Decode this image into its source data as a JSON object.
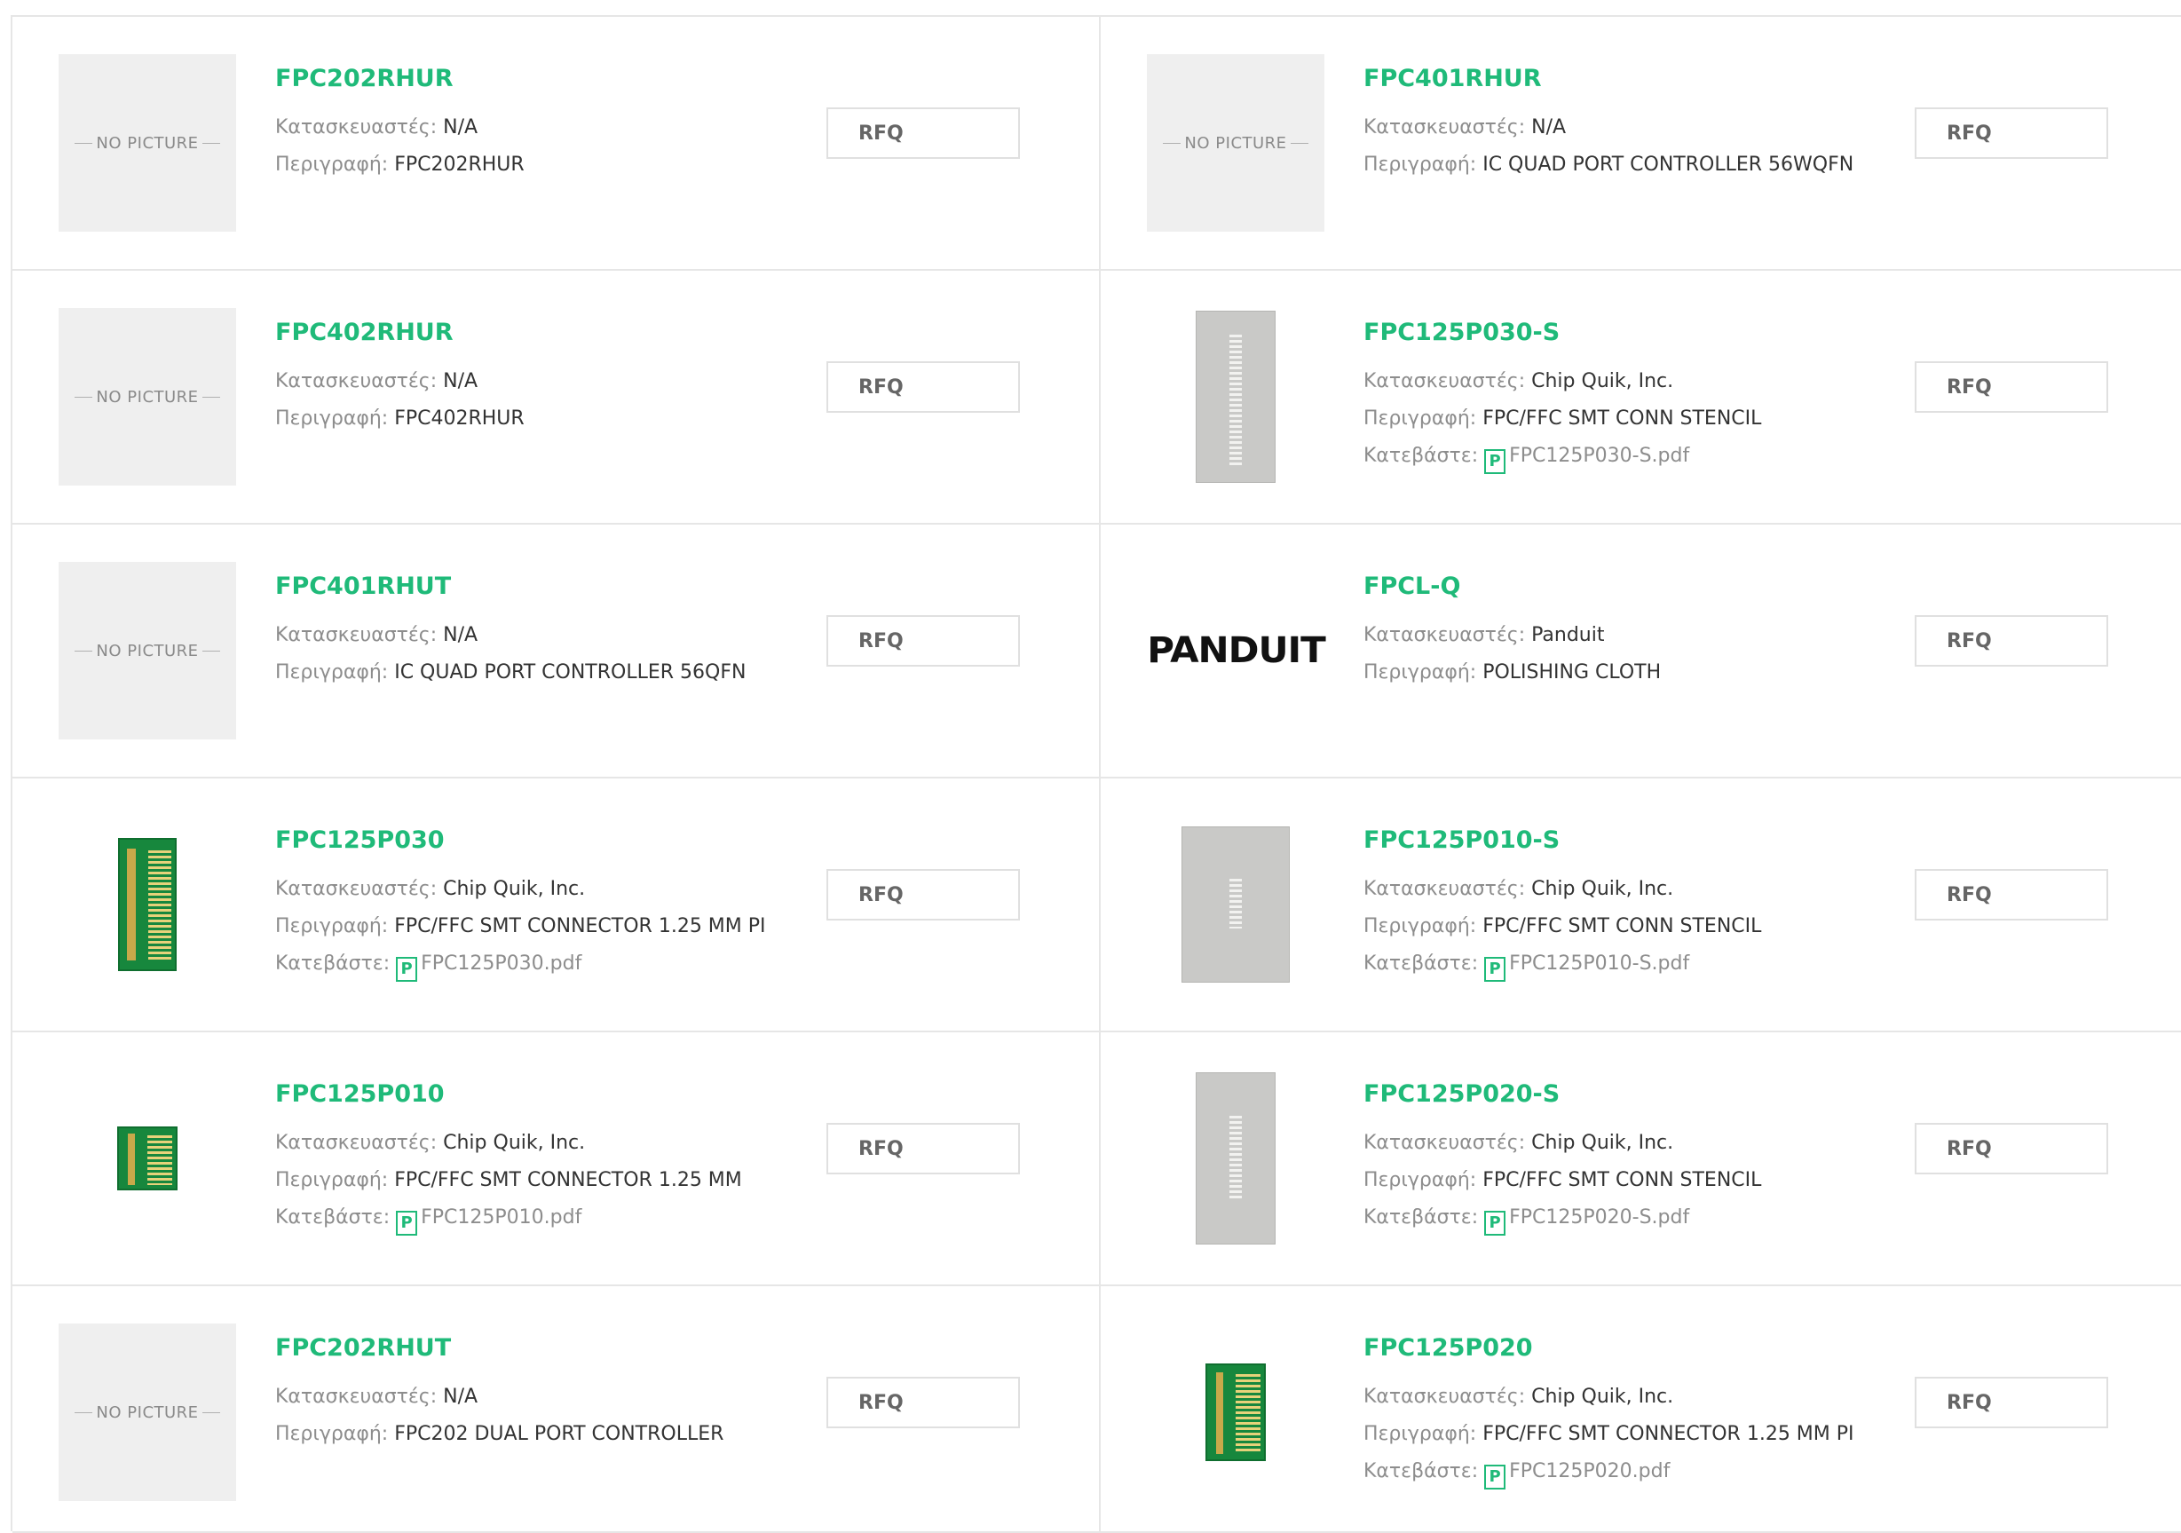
{
  "labels": {
    "manufacturer": "Κατασκευαστές:",
    "description": "Περιγραφή:",
    "download": "Κατεβάστε:",
    "no_picture": "NO PICTURE",
    "rfq": "RFQ",
    "pdf_icon_glyph": "P"
  },
  "colors": {
    "accent": "#1fba79",
    "label": "#8d8d8d",
    "value": "#333333"
  },
  "products": [
    {
      "part": "FPC202RHUR",
      "manufacturer": "N/A",
      "description": "FPC202RHUR",
      "image": "no-picture"
    },
    {
      "part": "FPC401RHUR",
      "manufacturer": "N/A",
      "description": "IC QUAD PORT CONTROLLER 56WQFN",
      "image": "no-picture"
    },
    {
      "part": "FPC402RHUR",
      "manufacturer": "N/A",
      "description": "FPC402RHUR",
      "image": "no-picture"
    },
    {
      "part": "FPC125P030-S",
      "manufacturer": "Chip Quik, Inc.",
      "description": "FPC/FFC SMT CONN STENCIL",
      "datasheet": "FPC125P030-S.pdf",
      "image": "stencil"
    },
    {
      "part": "FPC401RHUT",
      "manufacturer": "N/A",
      "description": "IC QUAD PORT CONTROLLER 56QFN",
      "image": "no-picture"
    },
    {
      "part": "FPCL-Q",
      "manufacturer": "Panduit",
      "description": "POLISHING CLOTH",
      "image": "panduit-logo",
      "logo_text": "PANDUIT"
    },
    {
      "part": "FPC125P030",
      "manufacturer": "Chip Quik, Inc.",
      "description": "FPC/FFC SMT CONNECTOR 1.25 MM PI",
      "datasheet": "FPC125P030.pdf",
      "image": "pcb"
    },
    {
      "part": "FPC125P010-S",
      "manufacturer": "Chip Quik, Inc.",
      "description": "FPC/FFC SMT CONN STENCIL",
      "datasheet": "FPC125P010-S.pdf",
      "image": "stencil"
    },
    {
      "part": "FPC125P010",
      "manufacturer": "Chip Quik, Inc.",
      "description": "FPC/FFC SMT CONNECTOR 1.25 MM",
      "datasheet": "FPC125P010.pdf",
      "image": "pcb"
    },
    {
      "part": "FPC125P020-S",
      "manufacturer": "Chip Quik, Inc.",
      "description": "FPC/FFC SMT CONN STENCIL",
      "datasheet": "FPC125P020-S.pdf",
      "image": "stencil"
    },
    {
      "part": "FPC202RHUT",
      "manufacturer": "N/A",
      "description": "FPC202 DUAL PORT CONTROLLER",
      "image": "no-picture"
    },
    {
      "part": "FPC125P020",
      "manufacturer": "Chip Quik, Inc.",
      "description": "FPC/FFC SMT CONNECTOR 1.25 MM PI",
      "datasheet": "FPC125P020.pdf",
      "image": "pcb"
    }
  ]
}
